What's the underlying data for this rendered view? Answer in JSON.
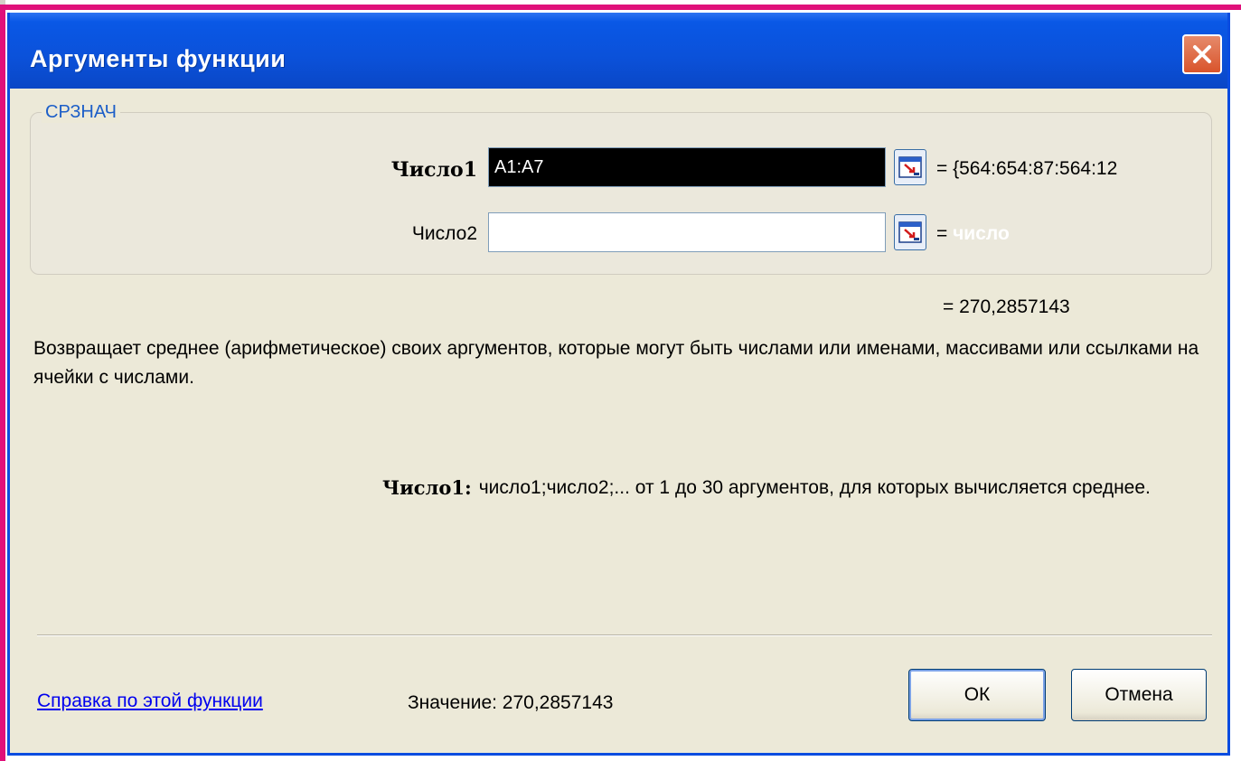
{
  "dialog": {
    "title": "Аргументы функции",
    "function_name": "СРЗНАЧ",
    "arguments": [
      {
        "label": "Число1",
        "value": "A1:A7",
        "preview": "= {564:654:87:564:12"
      },
      {
        "label": "Число2",
        "value": "",
        "preview_eq": "=",
        "preview_ghost": "число"
      }
    ],
    "result": "= 270,2857143",
    "description": "Возвращает среднее (арифметическое) своих аргументов, которые могут быть числами или именами, массивами или ссылками на ячейки с числами.",
    "arg_help_name": "Число1:",
    "arg_help_text": "число1;число2;... от 1 до 30 аргументов, для которых вычисляется среднее.",
    "help_link": "Справка по этой функции",
    "value_label": "Значение: 270,2857143",
    "ok_label": "ОК",
    "cancel_label": "Отмена"
  },
  "colors": {
    "titlebar": "#0b51d9",
    "frame_accent": "#e0107a",
    "dialog_bg": "#ece9d8"
  }
}
